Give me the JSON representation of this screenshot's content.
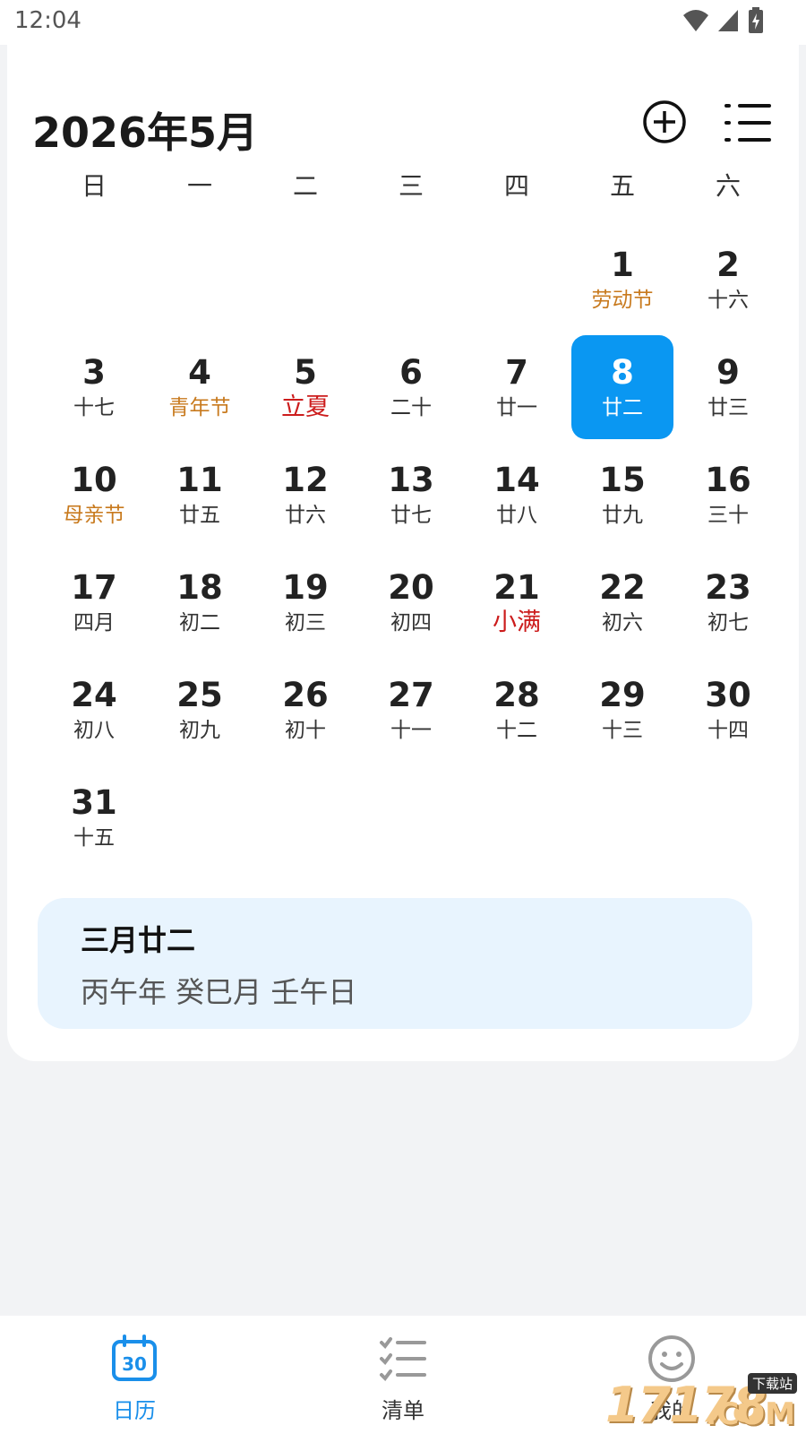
{
  "status_bar": {
    "time": "12:04",
    "icons": [
      "wifi-icon",
      "signal-icon",
      "battery-icon"
    ]
  },
  "header": {
    "title": "2026年5月",
    "add_icon": "plus-circle-icon",
    "menu_icon": "list-icon"
  },
  "weekdays": [
    "日",
    "一",
    "二",
    "三",
    "四",
    "五",
    "六"
  ],
  "calendar": {
    "selected_day": "8",
    "weeks": [
      [
        null,
        null,
        null,
        null,
        null,
        {
          "day": "1",
          "lunar": "劳动节",
          "kind": "festival"
        },
        {
          "day": "2",
          "lunar": "十六",
          "kind": "normal"
        }
      ],
      [
        {
          "day": "3",
          "lunar": "十七",
          "kind": "normal"
        },
        {
          "day": "4",
          "lunar": "青年节",
          "kind": "festival"
        },
        {
          "day": "5",
          "lunar": "立夏",
          "kind": "term"
        },
        {
          "day": "6",
          "lunar": "二十",
          "kind": "normal"
        },
        {
          "day": "7",
          "lunar": "廿一",
          "kind": "normal"
        },
        {
          "day": "8",
          "lunar": "廿二",
          "kind": "normal"
        },
        {
          "day": "9",
          "lunar": "廿三",
          "kind": "normal"
        }
      ],
      [
        {
          "day": "10",
          "lunar": "母亲节",
          "kind": "festival"
        },
        {
          "day": "11",
          "lunar": "廿五",
          "kind": "normal"
        },
        {
          "day": "12",
          "lunar": "廿六",
          "kind": "normal"
        },
        {
          "day": "13",
          "lunar": "廿七",
          "kind": "normal"
        },
        {
          "day": "14",
          "lunar": "廿八",
          "kind": "normal"
        },
        {
          "day": "15",
          "lunar": "廿九",
          "kind": "normal"
        },
        {
          "day": "16",
          "lunar": "三十",
          "kind": "normal"
        }
      ],
      [
        {
          "day": "17",
          "lunar": "四月",
          "kind": "normal"
        },
        {
          "day": "18",
          "lunar": "初二",
          "kind": "normal"
        },
        {
          "day": "19",
          "lunar": "初三",
          "kind": "normal"
        },
        {
          "day": "20",
          "lunar": "初四",
          "kind": "normal"
        },
        {
          "day": "21",
          "lunar": "小满",
          "kind": "term"
        },
        {
          "day": "22",
          "lunar": "初六",
          "kind": "normal"
        },
        {
          "day": "23",
          "lunar": "初七",
          "kind": "normal"
        }
      ],
      [
        {
          "day": "24",
          "lunar": "初八",
          "kind": "normal"
        },
        {
          "day": "25",
          "lunar": "初九",
          "kind": "normal"
        },
        {
          "day": "26",
          "lunar": "初十",
          "kind": "normal"
        },
        {
          "day": "27",
          "lunar": "十一",
          "kind": "normal"
        },
        {
          "day": "28",
          "lunar": "十二",
          "kind": "normal"
        },
        {
          "day": "29",
          "lunar": "十三",
          "kind": "normal"
        },
        {
          "day": "30",
          "lunar": "十四",
          "kind": "normal"
        }
      ],
      [
        {
          "day": "31",
          "lunar": "十五",
          "kind": "normal"
        },
        null,
        null,
        null,
        null,
        null,
        null
      ]
    ]
  },
  "colors": {
    "accent": "#0a97f2",
    "festival": "#c87a1e",
    "solar_term": "#cc1c1c",
    "info_bg": "#e8f4fe"
  },
  "info": {
    "lunar_date": "三月廿二",
    "ganzhi": "丙午年 癸巳月 壬午日"
  },
  "bottom_nav": {
    "items": [
      {
        "label": "日历",
        "icon": "calendar-icon",
        "icon_text": "30",
        "active": true
      },
      {
        "label": "清单",
        "icon": "checklist-icon",
        "active": false
      },
      {
        "label": "我的",
        "icon": "smiley-icon",
        "active": false
      }
    ]
  },
  "watermark": {
    "text": "17178",
    "badge": "下载站",
    "suffix": ".COM"
  }
}
